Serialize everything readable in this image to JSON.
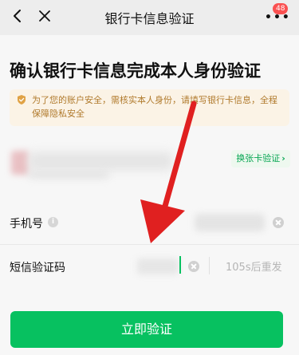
{
  "nav": {
    "title": "银行卡信息验证",
    "badge_count": "48",
    "back_icon": "chevron-left-icon",
    "close_icon": "close-icon",
    "more_icon": "more-dots-icon"
  },
  "main": {
    "headline": "确认银行卡信息完成本人身份验证",
    "notice": "为了您的账户安全，需核实本人身份，请填写银行卡信息，全程保障隐私安全",
    "notice_icon": "shield-icon"
  },
  "bank_card": {
    "switch_label": "换张卡验证"
  },
  "form": {
    "phone_label": "手机号",
    "sms_label": "短信验证码",
    "resend_text": "105s后重发"
  },
  "actions": {
    "submit_label": "立即验证"
  },
  "colors": {
    "accent": "#07c160",
    "annotation_arrow": "#e02020",
    "notice_text": "#b07a2c",
    "badge": "#fa5151"
  }
}
